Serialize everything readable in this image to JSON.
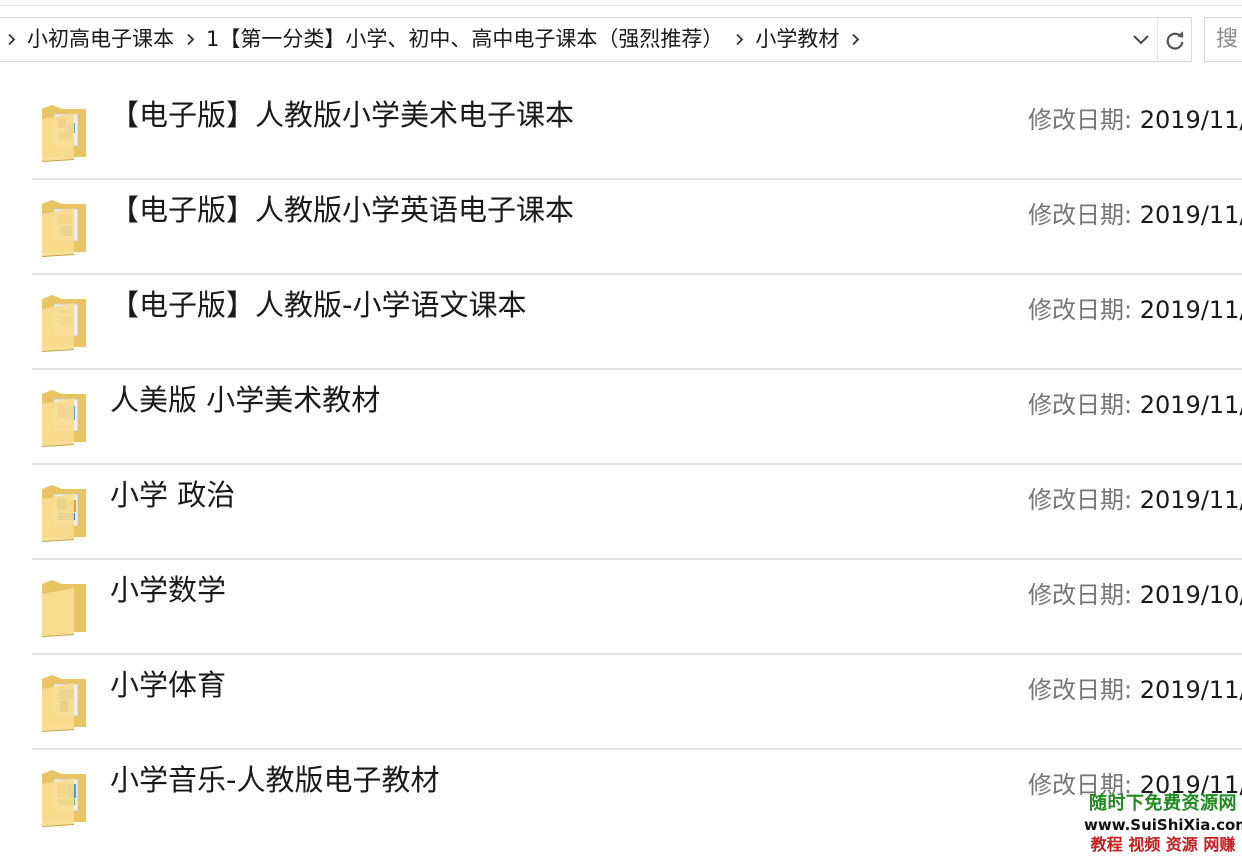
{
  "address_bar": {
    "breadcrumbs": [
      {
        "label": "小初高电子课本"
      },
      {
        "label": "1【第一分类】小学、初中、高中电子课本（强烈推荐）"
      },
      {
        "label": "小学教材"
      }
    ],
    "dropdown_icon": "chevron-down-icon",
    "refresh_icon": "refresh-icon"
  },
  "search": {
    "placeholder": "搜"
  },
  "meta_label": "修改日期:",
  "files": [
    {
      "name": "【电子版】人教版小学美术电子课本",
      "modified": "2019/11/",
      "icon": "folder-icon"
    },
    {
      "name": "【电子版】人教版小学英语电子课本",
      "modified": "2019/11/",
      "icon": "folder-icon"
    },
    {
      "name": "【电子版】人教版-小学语文课本",
      "modified": "2019/11/",
      "icon": "folder-icon"
    },
    {
      "name": "人美版 小学美术教材",
      "modified": "2019/11/",
      "icon": "folder-icon"
    },
    {
      "name": "小学 政治",
      "modified": "2019/11/",
      "icon": "folder-icon"
    },
    {
      "name": "小学数学",
      "modified": "2019/10/",
      "icon": "folder-icon"
    },
    {
      "name": "小学体育",
      "modified": "2019/11/",
      "icon": "folder-icon"
    },
    {
      "name": "小学音乐-人教版电子教材",
      "modified": "2019/11/",
      "icon": "folder-icon"
    }
  ],
  "watermark": {
    "line1": "随时下免费资源网",
    "line2": "www.SuiShiXia.com",
    "line3": "教程 视频 资源 网赚"
  },
  "colors": {
    "folder_back": "#e8c462",
    "folder_front": "#f7dc8f",
    "separator": "#e3e3e3",
    "meta_label": "#767676",
    "watermark_green": "#1f8a1f",
    "watermark_red": "#c41d1d"
  }
}
